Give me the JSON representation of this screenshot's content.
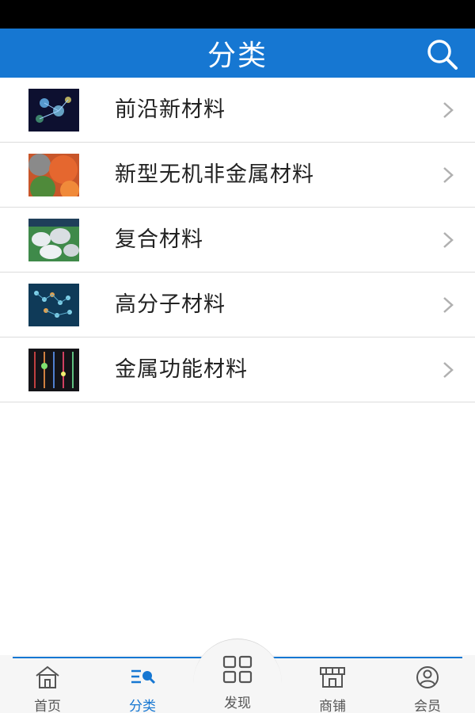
{
  "header": {
    "title": "分类",
    "search_icon": "search-icon"
  },
  "categories": [
    {
      "label": "前沿新材料",
      "thumb": "advanced-materials-image"
    },
    {
      "label": "新型无机非金属材料",
      "thumb": "inorganic-materials-image"
    },
    {
      "label": "复合材料",
      "thumb": "composite-materials-image"
    },
    {
      "label": "高分子材料",
      "thumb": "polymer-materials-image"
    },
    {
      "label": "金属功能材料",
      "thumb": "metal-materials-image"
    }
  ],
  "bottom_nav": {
    "items": [
      {
        "label": "首页",
        "icon": "home-icon",
        "active": false
      },
      {
        "label": "分类",
        "icon": "category-icon",
        "active": true
      },
      {
        "label": "发现",
        "icon": "grid-icon",
        "active": false
      },
      {
        "label": "商铺",
        "icon": "store-icon",
        "active": false
      },
      {
        "label": "会员",
        "icon": "user-icon",
        "active": false
      }
    ]
  },
  "colors": {
    "accent": "#1677d2",
    "header_bg": "#1677d2",
    "status_bar": "#000000"
  }
}
